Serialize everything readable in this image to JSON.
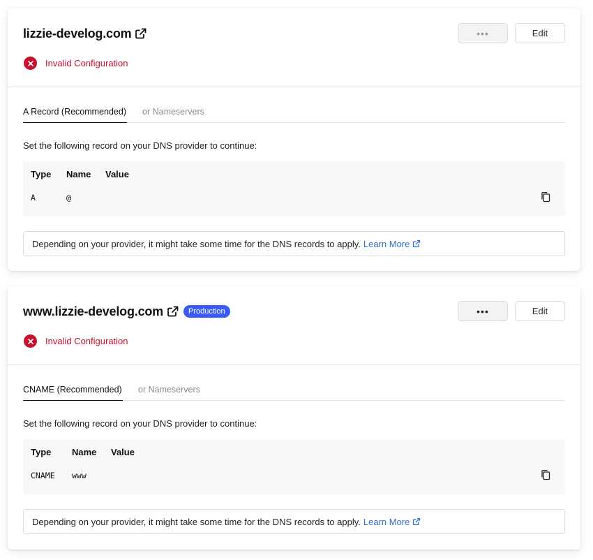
{
  "domains": [
    {
      "name": "lizzie-develog.com",
      "badge": "",
      "more_label": "•••",
      "edit_label": "Edit",
      "status": "Invalid Configuration",
      "tabs": [
        {
          "label": "A Record (Recommended)",
          "active": true
        },
        {
          "label": "or Nameservers",
          "active": false
        }
      ],
      "instruction": "Set the following record on your DNS provider to continue:",
      "record": {
        "headers": {
          "type": "Type",
          "name": "Name",
          "value": "Value"
        },
        "type": "A",
        "name": "@",
        "value": ""
      },
      "note": "Depending on your provider, it might take some time for the DNS records to apply.",
      "learn_more": "Learn More"
    },
    {
      "name": "www.lizzie-develog.com",
      "badge": "Production",
      "more_label": "•••",
      "edit_label": "Edit",
      "status": "Invalid Configuration",
      "tabs": [
        {
          "label": "CNAME (Recommended)",
          "active": true
        },
        {
          "label": "or Nameservers",
          "active": false
        }
      ],
      "instruction": "Set the following record on your DNS provider to continue:",
      "record": {
        "headers": {
          "type": "Type",
          "name": "Name",
          "value": "Value"
        },
        "type": "CNAME",
        "name": "www",
        "value": ""
      },
      "note": "Depending on your provider, it might take some time for the DNS records to apply.",
      "learn_more": "Learn More"
    }
  ],
  "colors": {
    "error": "#c8102e",
    "badge": "#3b5bf6",
    "link": "#2f6fd6"
  },
  "icons": [
    "external-link-icon",
    "error-x-icon",
    "copy-icon",
    "more-dots-icon"
  ]
}
